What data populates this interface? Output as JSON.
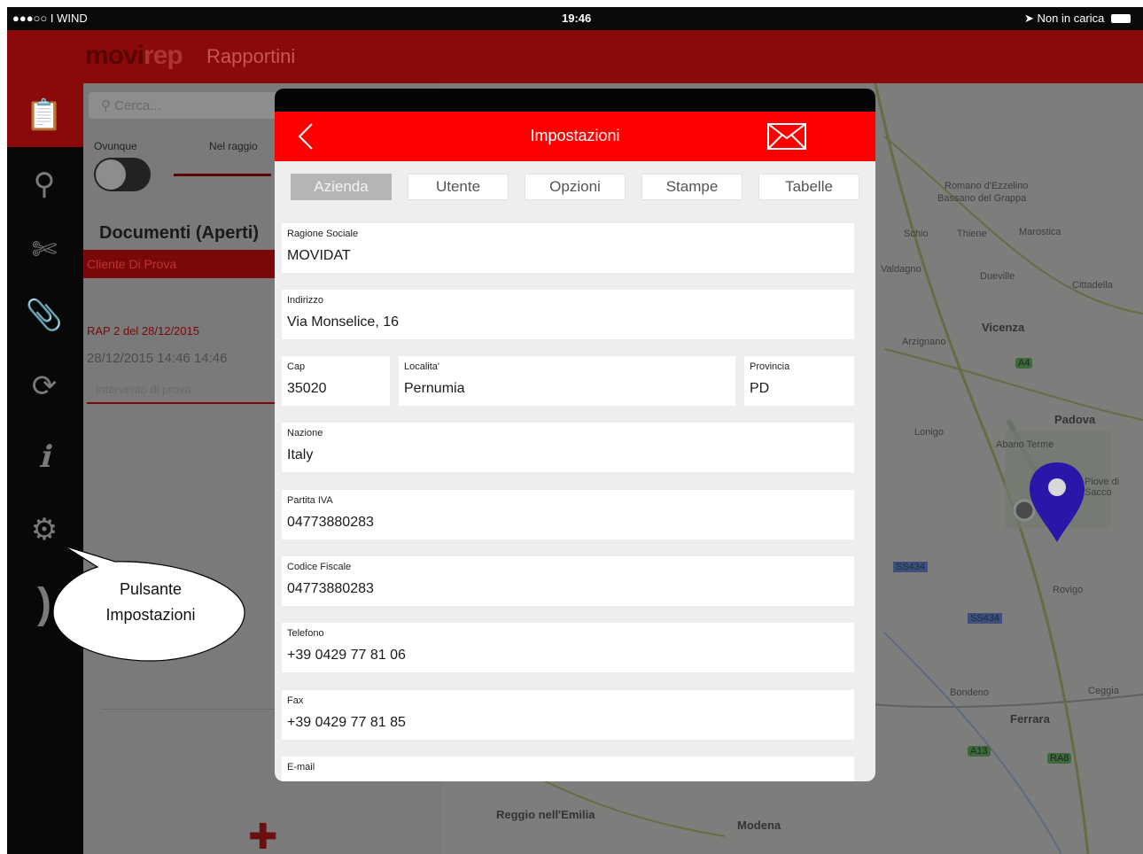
{
  "status_bar": {
    "carrier": "●●●○○ I WIND",
    "time": "19:46",
    "battery_text": "Non in carica"
  },
  "app_header": {
    "brand_light": "movi",
    "brand_bold": "rep",
    "section_title": "Rapportini"
  },
  "sidebar": {
    "items": [
      {
        "icon": "clipboard-icon",
        "glyph": "📋"
      },
      {
        "icon": "person-icon",
        "glyph": "⚲"
      },
      {
        "icon": "tools-icon",
        "glyph": "✄"
      },
      {
        "icon": "paperclip-icon",
        "glyph": "📎"
      },
      {
        "icon": "sync-icon",
        "glyph": "⟳"
      },
      {
        "icon": "info-icon",
        "glyph": "ℹ"
      },
      {
        "icon": "gear-icon",
        "glyph": "⚙"
      },
      {
        "icon": "logout-icon",
        "glyph": ")"
      }
    ]
  },
  "list_panel": {
    "search_placeholder": "Cerca...",
    "filter_anywhere": "Ovunque",
    "filter_radius": "Nel raggio",
    "documents_title": "Documenti (Aperti)",
    "client_name": "Cliente Di Prova",
    "report_title": "RAP 2 del 28/12/2015",
    "report_date": "28/12/2015  14:46  14:46",
    "report_note": "Intervento di prova",
    "add_glyph": "✚"
  },
  "map": {
    "towns": [
      {
        "name": "Romano d'Ezzelino",
        "big": false
      },
      {
        "name": "Bassano del Grappa",
        "big": false
      },
      {
        "name": "Thiene",
        "big": false
      },
      {
        "name": "Marostica",
        "big": false
      },
      {
        "name": "Schio",
        "big": false
      },
      {
        "name": "Valdagno",
        "big": false
      },
      {
        "name": "Dueville",
        "big": false
      },
      {
        "name": "Cittadella",
        "big": false
      },
      {
        "name": "Vicenza",
        "big": true
      },
      {
        "name": "Arzignano",
        "big": false
      },
      {
        "name": "Padova",
        "big": true
      },
      {
        "name": "Lonigo",
        "big": false
      },
      {
        "name": "Abano Terme",
        "big": false
      },
      {
        "name": "Piove di Sacco",
        "big": false
      },
      {
        "name": "Rovigo",
        "big": false
      },
      {
        "name": "Ferrara",
        "big": true
      },
      {
        "name": "Reggio nell'Emilia",
        "big": true
      },
      {
        "name": "Modena",
        "big": true
      },
      {
        "name": "Bondeno",
        "big": false
      },
      {
        "name": "Ceggia",
        "big": false
      }
    ],
    "road_badges": [
      "A4",
      "SS434",
      "SS434",
      "A13",
      "RA8"
    ]
  },
  "modal": {
    "title": "Impostazioni",
    "tabs": [
      {
        "label": "Azienda",
        "active": true
      },
      {
        "label": "Utente",
        "active": false
      },
      {
        "label": "Opzioni",
        "active": false
      },
      {
        "label": "Stampe",
        "active": false
      },
      {
        "label": "Tabelle",
        "active": false
      }
    ],
    "fields": {
      "ragione_sociale": {
        "label": "Ragione Sociale",
        "value": "MOVIDAT"
      },
      "indirizzo": {
        "label": "Indirizzo",
        "value": "Via Monselice, 16"
      },
      "cap": {
        "label": "Cap",
        "value": "35020"
      },
      "localita": {
        "label": "Localita'",
        "value": "Pernumia"
      },
      "provincia": {
        "label": "Provincia",
        "value": "PD"
      },
      "nazione": {
        "label": "Nazione",
        "value": "Italy"
      },
      "partita_iva": {
        "label": "Partita IVA",
        "value": "04773880283"
      },
      "codice_fiscale": {
        "label": "Codice Fiscale",
        "value": "04773880283"
      },
      "telefono": {
        "label": "Telefono",
        "value": "+39 0429 77 81 06"
      },
      "fax": {
        "label": "Fax",
        "value": "+39 0429 77 81 85"
      },
      "email": {
        "label": "E-mail",
        "value": ""
      }
    }
  },
  "callout": {
    "line1": "Pulsante",
    "line2": "Impostazioni"
  },
  "colors": {
    "accent_red": "#ff0000",
    "brand_dark_red": "#8a0a0a",
    "pin_blue": "#2a16a8"
  }
}
